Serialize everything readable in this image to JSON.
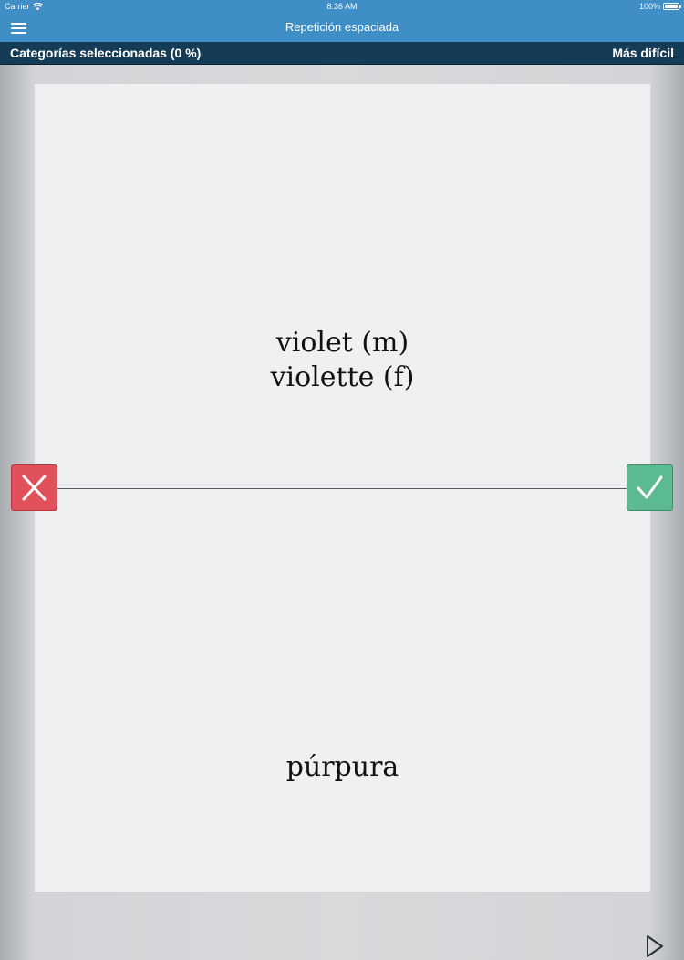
{
  "status_bar": {
    "carrier": "Carrier",
    "time": "8:36 AM",
    "battery": "100%",
    "battery_level": 1.0
  },
  "nav": {
    "title": "Repetición espaciada",
    "menu_icon": "hamburger-menu-icon"
  },
  "category_bar": {
    "selected_label": "Categorías seleccionadas (0 %)",
    "difficulty_label": "Más difícil"
  },
  "card": {
    "front_lines": [
      "violet (m)",
      "violette (f)"
    ],
    "back_text": "púrpura"
  },
  "actions": {
    "wrong_icon": "x-icon",
    "right_icon": "checkmark-icon",
    "play_icon": "play-icon"
  },
  "colors": {
    "header_blue": "#3f8ec6",
    "category_bar_navy": "#153c57",
    "wrong_red": "#e1515c",
    "right_green": "#5bba8f",
    "card_background": "#eef0f2"
  }
}
